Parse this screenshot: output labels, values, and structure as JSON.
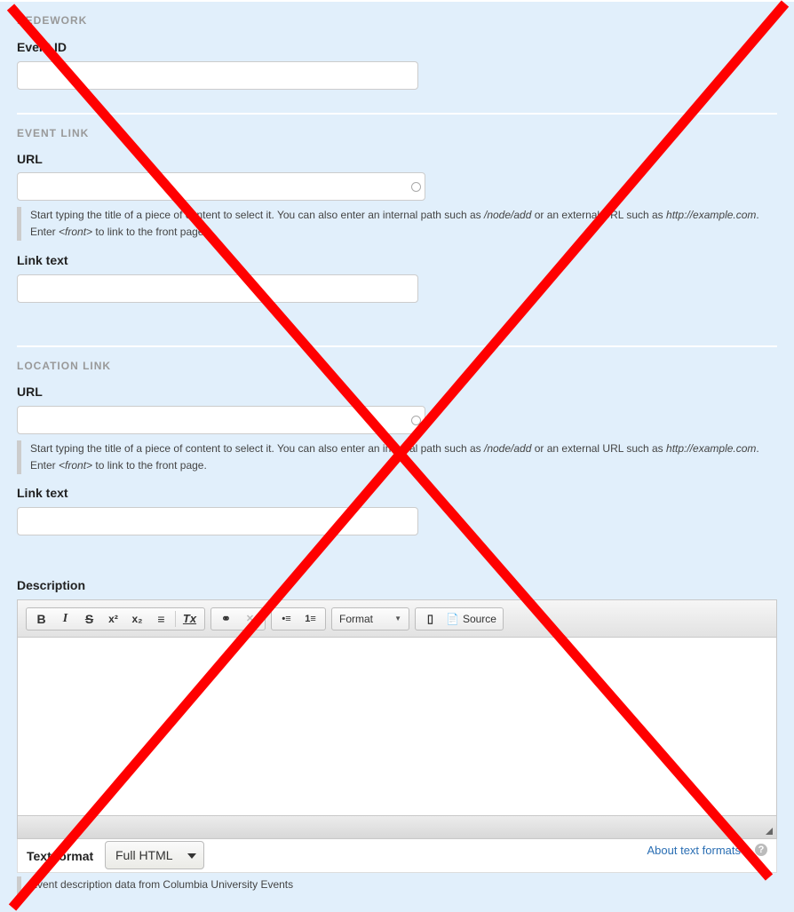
{
  "bedework": {
    "section_title": "BEDEWORK",
    "event_id_label": "Event ID",
    "event_id_value": ""
  },
  "event_link": {
    "section_title": "EVENT LINK",
    "url_label": "URL",
    "url_value": "",
    "help_line1_a": "Start typing the title of a piece of content to select it. You can also enter an internal path such as ",
    "help_line1_path": "/node/add",
    "help_line1_b": " or an external URL such as ",
    "help_line1_url": "http://example.com",
    "help_line1_c": ".",
    "help_line2_a": "Enter ",
    "help_line2_front": "<front>",
    "help_line2_b": " to link to the front page.",
    "link_text_label": "Link text",
    "link_text_value": ""
  },
  "location_link": {
    "section_title": "LOCATION LINK",
    "url_label": "URL",
    "url_value": "",
    "help_line1_a": "Start typing the title of a piece of content to select it. You can also enter an internal path such as ",
    "help_line1_path": "/node/add",
    "help_line1_b": " or an external URL such as ",
    "help_line1_url": "http://example.com",
    "help_line1_c": ".",
    "help_line2_a": "Enter ",
    "help_line2_front": "<front>",
    "help_line2_b": " to link to the front page.",
    "link_text_label": "Link text",
    "link_text_value": ""
  },
  "description": {
    "label": "Description",
    "toolbar": {
      "bold": "B",
      "italic": "I",
      "strike": "S",
      "superscript": "x²",
      "subscript": "x₂",
      "align": "≡",
      "remove_format": "Tx",
      "link": "⚭",
      "unlink": "✕",
      "bullet_list": "•≡",
      "numbered_list": "1≡",
      "format_label": "Format",
      "source_label": "Source"
    },
    "text_format_label": "Text format",
    "text_format_value": "Full HTML",
    "about_link": "About text formats",
    "help": "Event description data from Columbia University Events"
  },
  "overlay": {
    "color": "#ff0000"
  }
}
